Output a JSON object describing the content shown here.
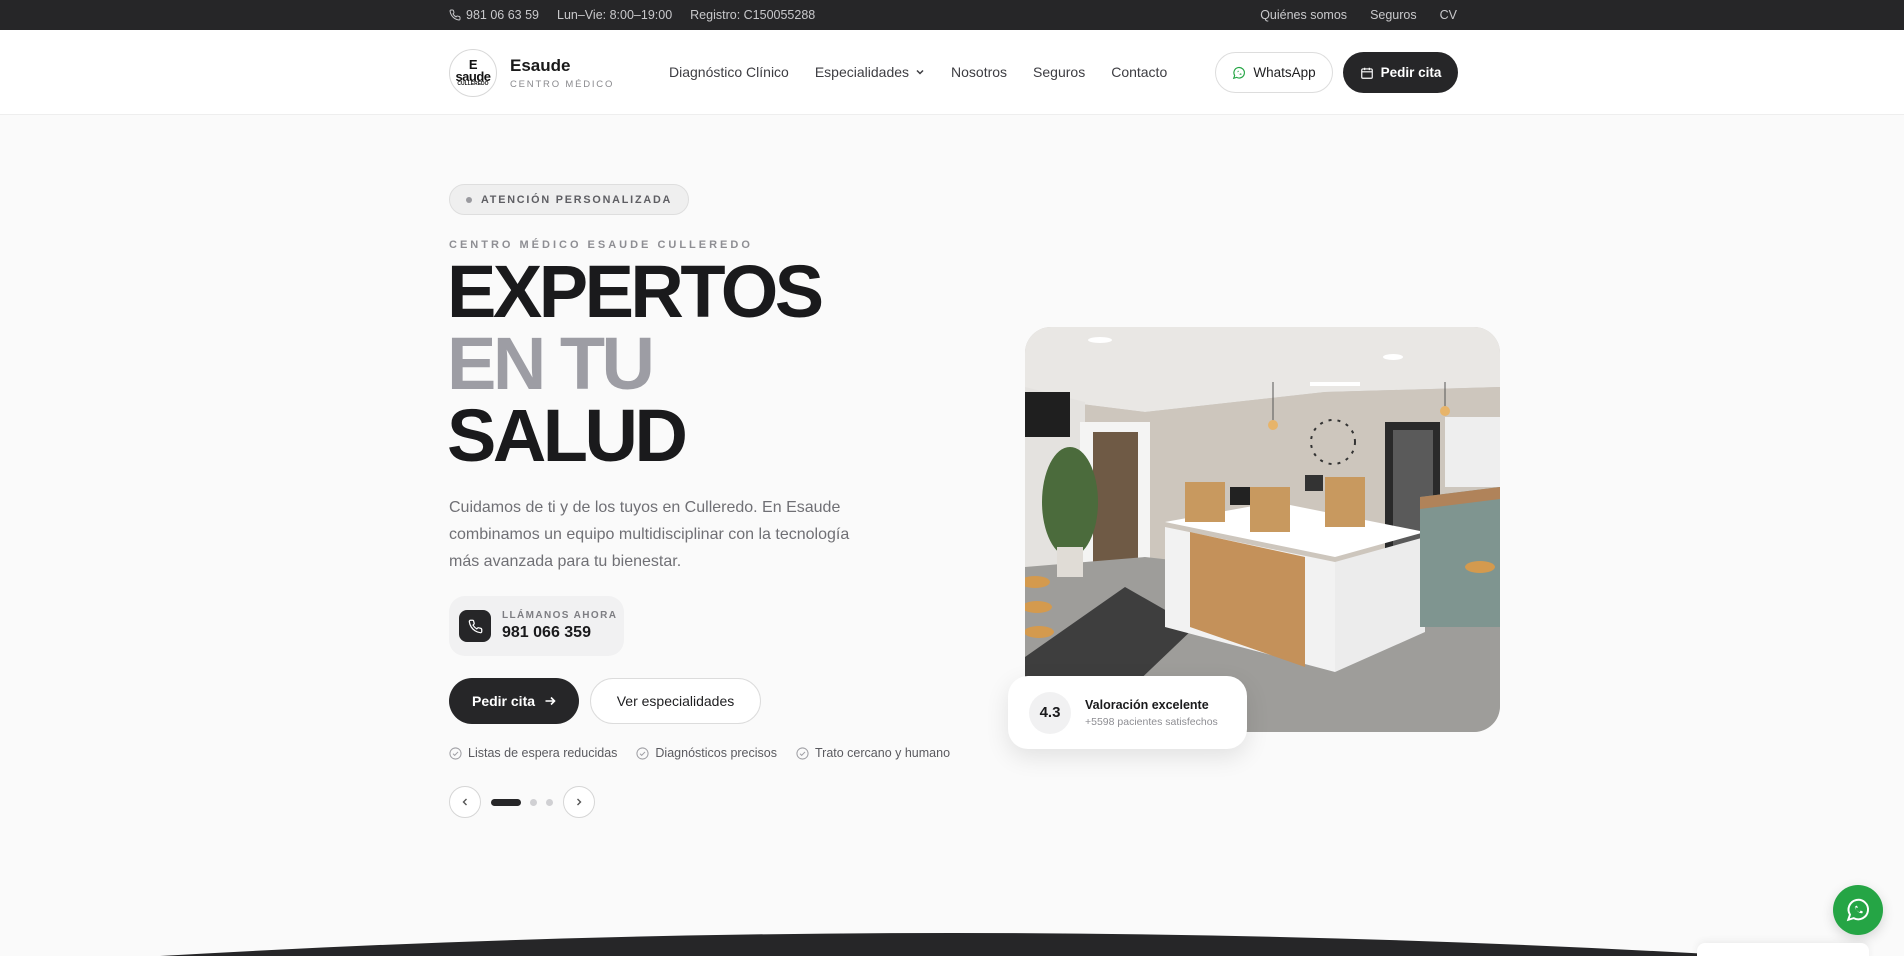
{
  "topbar": {
    "phone": "981 06 63 59",
    "hours": "Lun–Vie: 8:00–19:00",
    "registry": "Registro: C150055288",
    "links": [
      "Quiénes somos",
      "Seguros",
      "CV"
    ]
  },
  "header": {
    "logo_name": "Esaude",
    "logo_sub": "CENTRO MÉDICO",
    "nav": [
      "Diagnóstico Clínico",
      "Especialidades",
      "Nosotros",
      "Seguros",
      "Contacto"
    ],
    "whatsapp_label": "WhatsApp",
    "cita_label": "Pedir cita"
  },
  "hero": {
    "badge": "ATENCIÓN PERSONALIZADA",
    "eyebrow": "CENTRO MÉDICO ESAUDE CULLEREDO",
    "title_line1": "EXPERTOS",
    "title_line2": "EN TU",
    "title_line3": "SALUD",
    "description": "Cuidamos de ti y de los tuyos en Culleredo. En Esaude combinamos un equipo multidisciplinar con la tecnología más avanzada para tu bienestar.",
    "call_label": "LLÁMANOS AHORA",
    "call_number": "981 066 359",
    "primary_button": "Pedir cita",
    "secondary_button": "Ver especialidades",
    "features": [
      "Listas de espera reducidas",
      "Diagnósticos precisos",
      "Trato cercano y humano"
    ],
    "slides_total": 3,
    "slide_active": 1
  },
  "rating": {
    "score": "4.3",
    "title": "Valoración excelente",
    "subtitle": "+5598 pacientes satisfechos"
  },
  "colors": {
    "dark": "#262628",
    "muted_title": "#9d9da4",
    "whatsapp_green": "#25a545"
  }
}
